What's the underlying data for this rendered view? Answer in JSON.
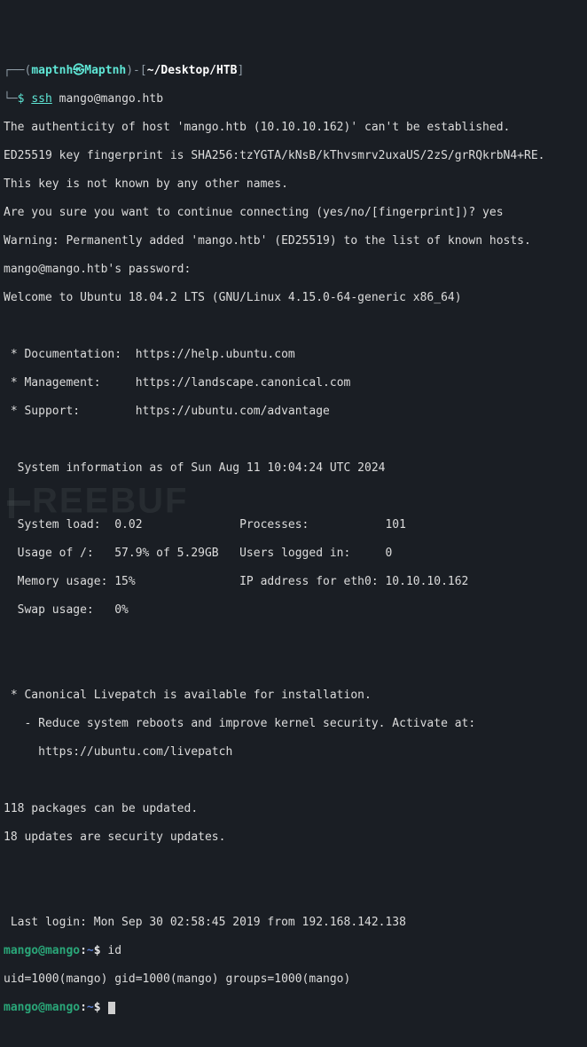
{
  "p1": {
    "bracket_open": "┌──(",
    "user": "maptnh㉿Maptnh",
    "bracket_mid": ")-[",
    "path": "~/Desktop/HTB",
    "bracket_close": "]",
    "arrow": "└─",
    "dollar": "$ ",
    "cmd_name": "ssh",
    "cmd_args": " mango@mango.htb"
  },
  "ssh_lines": [
    "The authenticity of host 'mango.htb (10.10.10.162)' can't be established.",
    "ED25519 key fingerprint is SHA256:tzYGTA/kNsB/kThvsmrv2uxaUS/2zS/grRQkrbN4+RE.",
    "This key is not known by any other names.",
    "Are you sure you want to continue connecting (yes/no/[fingerprint])? yes",
    "Warning: Permanently added 'mango.htb' (ED25519) to the list of known hosts.",
    "mango@mango.htb's password:"
  ],
  "motd_welcome": "Welcome to Ubuntu 18.04.2 LTS (GNU/Linux 4.15.0-64-generic x86_64)",
  "motd_links": {
    "doc_label": " * Documentation:  ",
    "doc_url": "https://help.ubuntu.com",
    "man_label": " * Management:     ",
    "man_url": "https://landscape.canonical.com",
    "sup_label": " * Support:        ",
    "sup_url": "https://ubuntu.com/advantage"
  },
  "sysinfo_header": "  System information as of Sun Aug 11 10:04:24 UTC 2024",
  "sysinfo_lines": [
    "  System load:  0.02              Processes:           101",
    "  Usage of /:   57.9% of 5.29GB   Users logged in:     0",
    "  Memory usage: 15%               IP address for eth0: 10.10.10.162",
    "  Swap usage:   0%"
  ],
  "livepatch": {
    "l1": " * Canonical Livepatch is available for installation.",
    "l2": "   - Reduce system reboots and improve kernel security. Activate at:",
    "l3": "     https://ubuntu.com/livepatch"
  },
  "updates": {
    "l1": "118 packages can be updated.",
    "l2": "18 updates are security updates."
  },
  "last_login": " Last login: Mon Sep 30 02:58:45 2019 from 192.168.142.138",
  "p2": {
    "user": "mango@mango",
    "colon": ":",
    "path": "~",
    "dollar": "$ "
  },
  "cmd_id": "id",
  "id_output": "uid=1000(mango) gid=1000(mango) groups=1000(mango)",
  "watermark": "REEBUF"
}
